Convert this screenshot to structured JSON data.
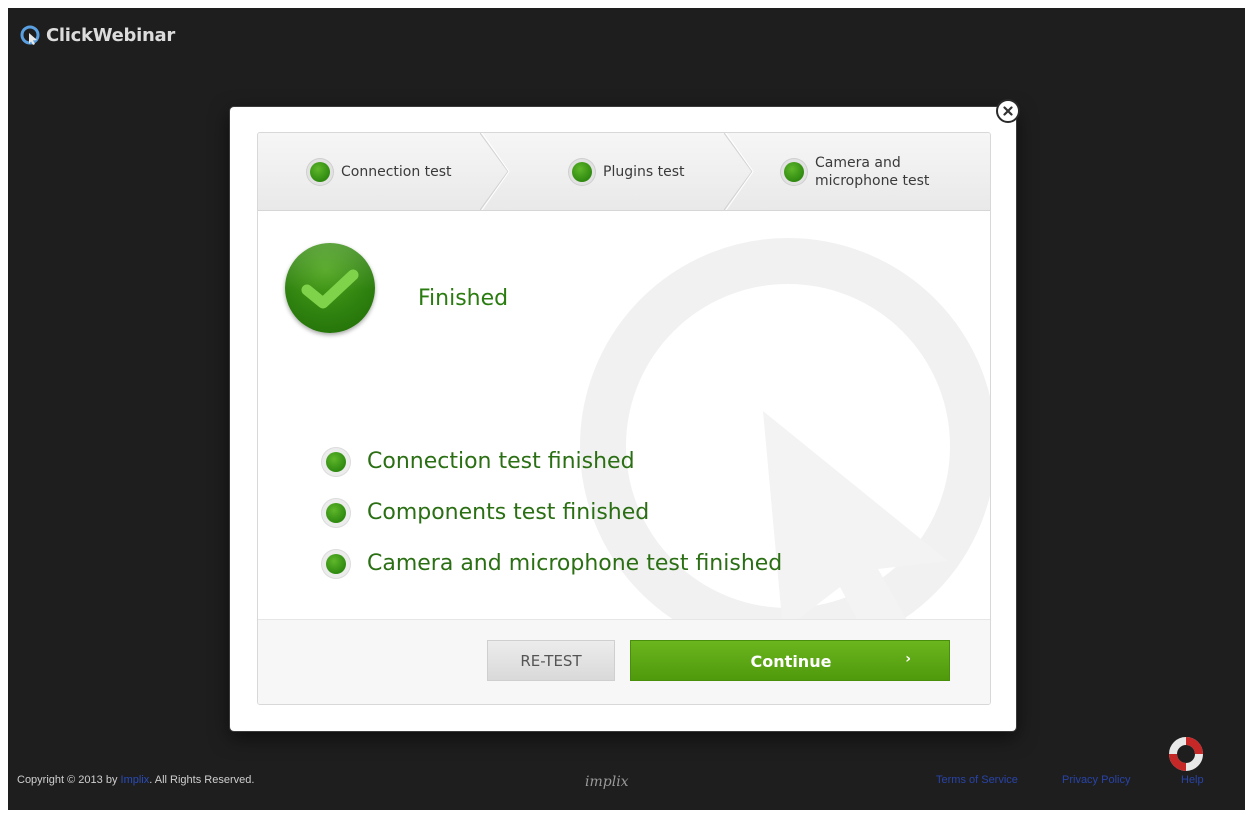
{
  "app": {
    "title": "ClickWebinar"
  },
  "steps": [
    {
      "label": "Connection test",
      "status": "complete"
    },
    {
      "label": "Plugins test",
      "status": "complete"
    },
    {
      "label": "Camera and microphone test",
      "status": "complete"
    }
  ],
  "status": {
    "title": "Finished",
    "icon": "checkmark-icon"
  },
  "results": [
    {
      "label": "Connection test finished"
    },
    {
      "label": "Components test finished"
    },
    {
      "label": "Camera and microphone test finished"
    }
  ],
  "buttons": {
    "retest": "RE-TEST",
    "continue": "Continue",
    "continue_arrow": "›"
  },
  "footer": {
    "copyright_prefix": "Copyright © 2013 by",
    "company": "Implix",
    "copyright_suffix": ". All Rights Reserved.",
    "brand": "implix",
    "links": [
      "Terms of Service",
      "Privacy Policy",
      "Help"
    ]
  },
  "colors": {
    "accent": "#4f9a0c",
    "text_green": "#2b6f14",
    "background": "#1e1e1e"
  }
}
